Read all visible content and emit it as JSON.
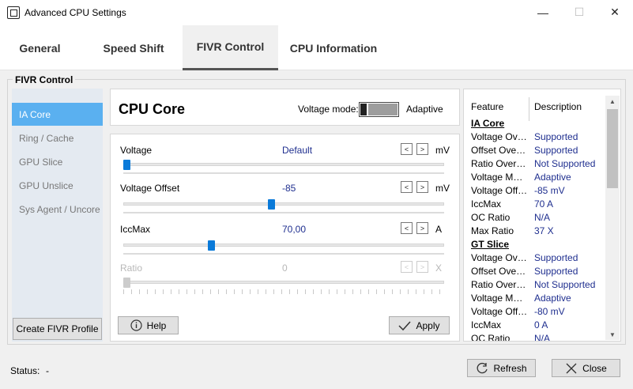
{
  "window": {
    "title": "Advanced CPU Settings",
    "controls": {
      "minimize": "—",
      "maximize": "☐",
      "close": "✕"
    }
  },
  "tabs": [
    {
      "label": "General"
    },
    {
      "label": "Speed Shift"
    },
    {
      "label": "FIVR Control",
      "active": true
    },
    {
      "label": "CPU Information"
    }
  ],
  "group": {
    "title": "FIVR Control"
  },
  "sidebar": {
    "items": [
      {
        "label": "IA Core",
        "active": true
      },
      {
        "label": "Ring / Cache"
      },
      {
        "label": "GPU Slice"
      },
      {
        "label": "GPU Unslice"
      },
      {
        "label": "Sys Agent / Uncore"
      }
    ],
    "create_profile_label": "Create FIVR Profile"
  },
  "core": {
    "title": "CPU Core",
    "voltage_mode_label": "Voltage mode:",
    "voltage_mode_value": "Adaptive"
  },
  "params": [
    {
      "label": "Voltage",
      "value": "Default",
      "unit": "mV",
      "level": 0.0,
      "enabled": true
    },
    {
      "label": "Voltage Offset",
      "value": "-85",
      "unit": "mV",
      "level": 0.46,
      "enabled": true
    },
    {
      "label": "IccMax",
      "value": "70,00",
      "unit": "A",
      "level": 0.27,
      "enabled": true
    },
    {
      "label": "Ratio",
      "value": "0",
      "unit": "X",
      "level": 0.0,
      "enabled": false
    }
  ],
  "arrows": {
    "left": "<",
    "right": ">"
  },
  "buttons": {
    "help": "Help",
    "apply": "Apply",
    "refresh": "Refresh",
    "close": "Close"
  },
  "features": {
    "header_feature": "Feature",
    "header_description": "Description",
    "sections": [
      {
        "title": "IA Core",
        "rows": [
          {
            "feature": "Voltage Override",
            "feature_display": "Voltage Over...",
            "description": "Supported"
          },
          {
            "feature": "Offset Override",
            "feature_display": "Offset Override",
            "description": "Supported"
          },
          {
            "feature": "Ratio Override",
            "feature_display": "Ratio Override",
            "description": "Not Supported"
          },
          {
            "feature": "Voltage Mode",
            "feature_display": "Voltage Mode",
            "description": "Adaptive"
          },
          {
            "feature": "Voltage Offset",
            "feature_display": "Voltage Offset",
            "description": "-85 mV"
          },
          {
            "feature": "IccMax",
            "feature_display": "IccMax",
            "description": "70 A"
          },
          {
            "feature": "OC Ratio",
            "feature_display": "OC Ratio",
            "description": "N/A"
          },
          {
            "feature": "Max Ratio",
            "feature_display": "Max Ratio",
            "description": "37 X"
          }
        ]
      },
      {
        "title": "GT Slice",
        "rows": [
          {
            "feature": "Voltage Override",
            "feature_display": "Voltage Over...",
            "description": "Supported"
          },
          {
            "feature": "Offset Override",
            "feature_display": "Offset Override",
            "description": "Supported"
          },
          {
            "feature": "Ratio Override",
            "feature_display": "Ratio Override",
            "description": "Not Supported"
          },
          {
            "feature": "Voltage Mode",
            "feature_display": "Voltage Mode",
            "description": "Adaptive"
          },
          {
            "feature": "Voltage Offset",
            "feature_display": "Voltage Offset",
            "description": "-80 mV"
          },
          {
            "feature": "IccMax",
            "feature_display": "IccMax",
            "description": "0 A"
          },
          {
            "feature": "OC Ratio",
            "feature_display": "OC Ratio",
            "description": "N/A"
          }
        ]
      }
    ]
  },
  "status": {
    "label": "Status:",
    "value": "-"
  },
  "colors": {
    "accent": "#5ab0f0",
    "slider_thumb": "#0a7ad9",
    "value_text": "#1f2f8f"
  }
}
